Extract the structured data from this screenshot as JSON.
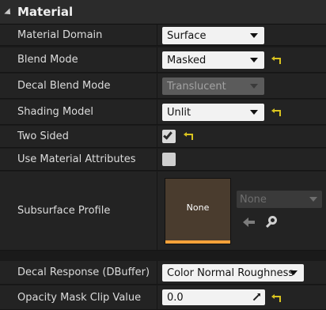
{
  "section": {
    "title": "Material"
  },
  "rows": {
    "material_domain": {
      "label": "Material Domain",
      "value": "Surface"
    },
    "blend_mode": {
      "label": "Blend Mode",
      "value": "Masked"
    },
    "decal_blend_mode": {
      "label": "Decal Blend Mode",
      "value": "Translucent"
    },
    "shading_model": {
      "label": "Shading Model",
      "value": "Unlit"
    },
    "two_sided": {
      "label": "Two Sided",
      "checked": true
    },
    "use_material_attributes": {
      "label": "Use Material Attributes",
      "checked": false
    },
    "subsurface_profile": {
      "label": "Subsurface Profile",
      "thumbnail_label": "None",
      "asset_value": "None"
    },
    "decal_response": {
      "label": "Decal Response (DBuffer)",
      "value": "Color Normal Roughness"
    },
    "opacity_mask_clip_value": {
      "label": "Opacity Mask Clip Value",
      "value": "0.0"
    }
  },
  "colors": {
    "reset_arrow": "#d9c31f",
    "thumbnail_accent": "#f7a23a",
    "thumbnail_bg": "#4a3c2e"
  }
}
